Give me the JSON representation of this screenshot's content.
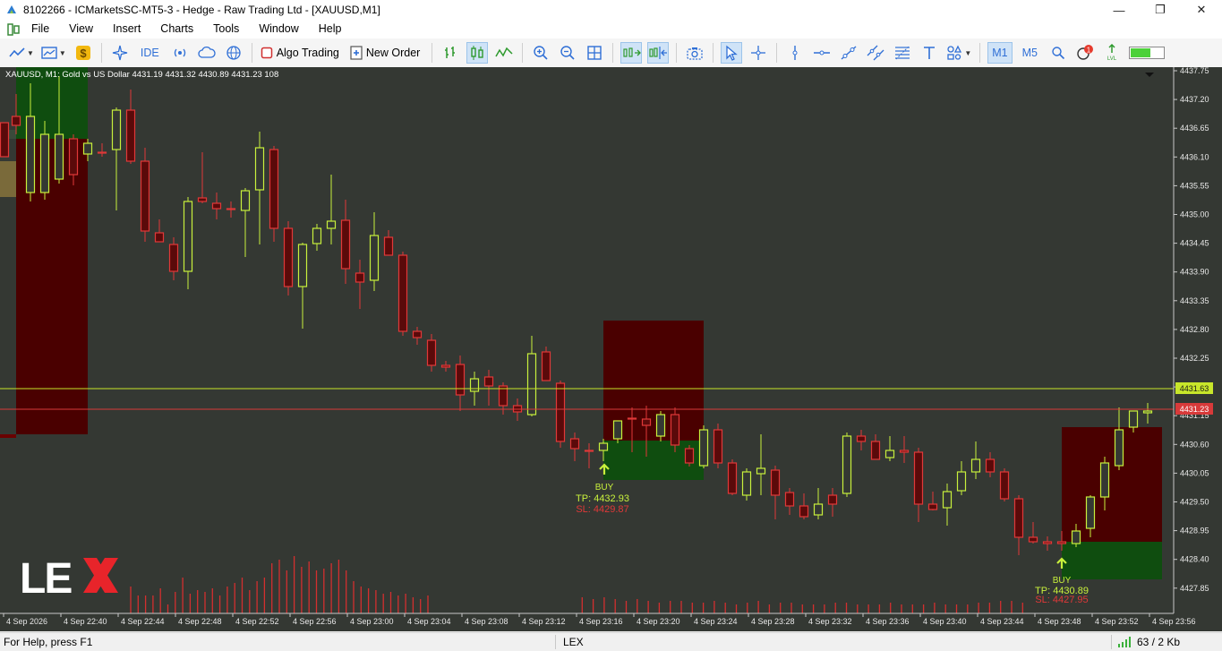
{
  "window": {
    "title": "8102266 - ICMarketsSC-MT5-3 - Hedge - Raw Trading Ltd - [XAUUSD,M1]",
    "minimize": "—",
    "maximize": "❐",
    "close": "✕"
  },
  "menu": [
    "File",
    "View",
    "Insert",
    "Charts",
    "Tools",
    "Window",
    "Help"
  ],
  "toolbar": {
    "ide_label": "IDE",
    "algo_trading_label": "Algo Trading",
    "new_order_label": "New Order",
    "timeframe_m1": "M1",
    "timeframe_m5": "M5",
    "notification_count": "1",
    "accent": "#2f6fd6"
  },
  "chart": {
    "info": "XAUUSD, M1:  Gold vs US Dollar  4431.19 4431.32 4430.89 4431.23  108",
    "background": "#343833",
    "bull_color": "#c8f03c",
    "bear_color": "#e03838",
    "ask_price": "4431.63",
    "bid_price": "4431.23",
    "ask_color": "#c8e62a",
    "bid_color": "#d83a3a",
    "price_ticks": [
      "4437.75",
      "4437.20",
      "4436.65",
      "4436.10",
      "4435.55",
      "4435.00",
      "4434.45",
      "4433.90",
      "4433.35",
      "4432.80",
      "4432.25",
      "4431.70",
      "4431.15",
      "4430.60",
      "4430.05",
      "4429.50",
      "4428.95",
      "4428.40",
      "4427.85"
    ],
    "time_ticks": [
      "4 Sep 2026",
      "4 Sep 22:40",
      "4 Sep 22:44",
      "4 Sep 22:48",
      "4 Sep 22:52",
      "4 Sep 22:56",
      "4 Sep 23:00",
      "4 Sep 23:04",
      "4 Sep 23:08",
      "4 Sep 23:12",
      "4 Sep 23:16",
      "4 Sep 23:20",
      "4 Sep 23:24",
      "4 Sep 23:28",
      "4 Sep 23:32",
      "4 Sep 23:36",
      "4 Sep 23:40",
      "4 Sep 23:44",
      "4 Sep 23:48",
      "4 Sep 23:52",
      "4 Sep 23:56"
    ],
    "trades": [
      {
        "side": "BUY",
        "tp": "TP: 4432.93",
        "sl": "SL: 4429.87"
      },
      {
        "side": "BUY",
        "tp": "TP: 4430.89",
        "sl": "SL: 4427.95"
      }
    ],
    "logo_text": "LEX"
  },
  "status": {
    "help": "For Help, press F1",
    "profile": "LEX",
    "traffic": "63 / 2 Kb"
  }
}
